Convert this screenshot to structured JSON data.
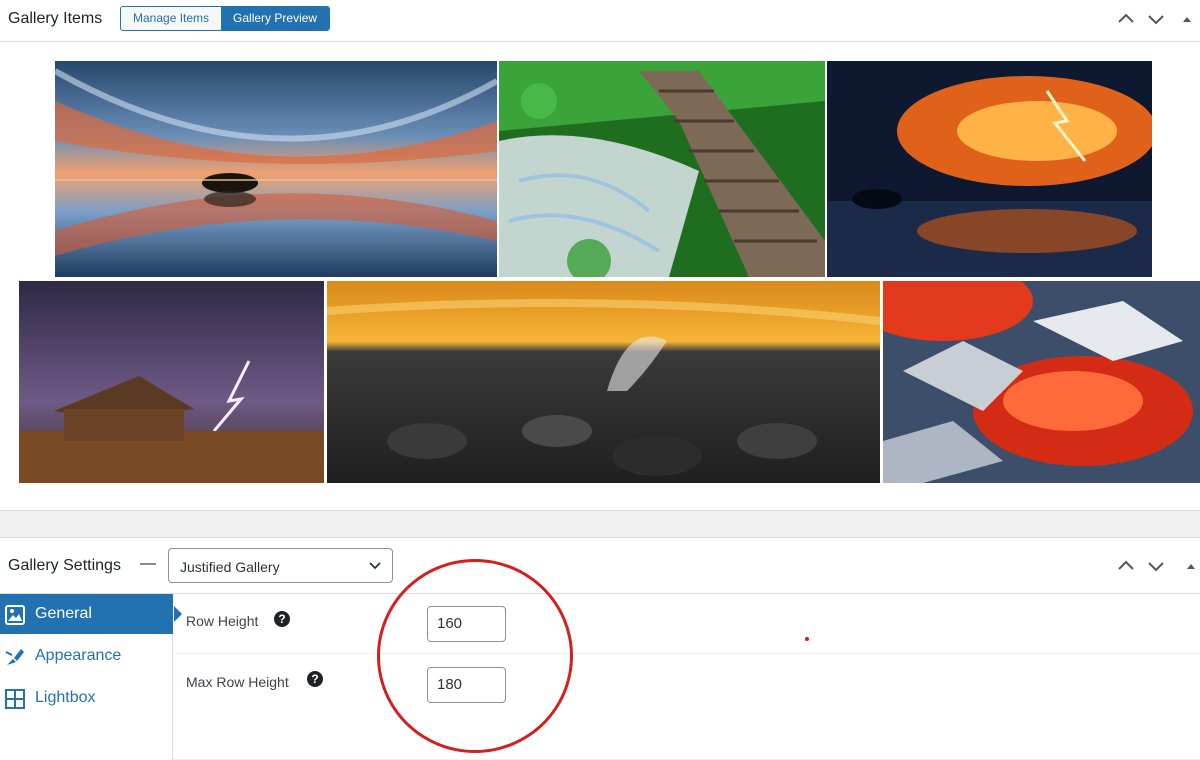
{
  "gallery_panel": {
    "title": "Gallery Items",
    "tabs": [
      {
        "label": "Manage Items",
        "active": false
      },
      {
        "label": "Gallery Preview",
        "active": true
      }
    ],
    "images": [
      {
        "name": "sky-reflection-island",
        "colors": [
          "#2d4d74",
          "#e46a3a",
          "#9ab8d8"
        ]
      },
      {
        "name": "waterfall-boardwalk",
        "colors": [
          "#2e8b2e",
          "#dfe8ef",
          "#7a6a58"
        ]
      },
      {
        "name": "fiery-storm-clouds",
        "colors": [
          "#0f1a30",
          "#f2781b",
          "#ffd06a"
        ]
      },
      {
        "name": "lightning-barn",
        "colors": [
          "#3a3150",
          "#6e5a86",
          "#8a5a2b"
        ]
      },
      {
        "name": "sunset-rocky-shore",
        "colors": [
          "#f0a21f",
          "#2a2a2a",
          "#5c5c5c"
        ]
      },
      {
        "name": "glowing-embers",
        "colors": [
          "#3d4e6b",
          "#e8391e",
          "#c8cdd6"
        ]
      }
    ]
  },
  "settings_panel": {
    "title": "Gallery Settings",
    "separator": "—",
    "gallery_type": "Justified Gallery",
    "tabs": [
      {
        "label": "General",
        "icon": "image-icon",
        "active": true
      },
      {
        "label": "Appearance",
        "icon": "brush-icon",
        "active": false
      },
      {
        "label": "Lightbox",
        "icon": "grid-icon",
        "active": false
      }
    ],
    "fields": [
      {
        "label": "Row Height",
        "value": "160"
      },
      {
        "label": "Max Row Height",
        "value": "180"
      }
    ],
    "help_glyph": "?"
  },
  "colors": {
    "accent": "#2271b1",
    "annotation": "#d41f1f"
  }
}
